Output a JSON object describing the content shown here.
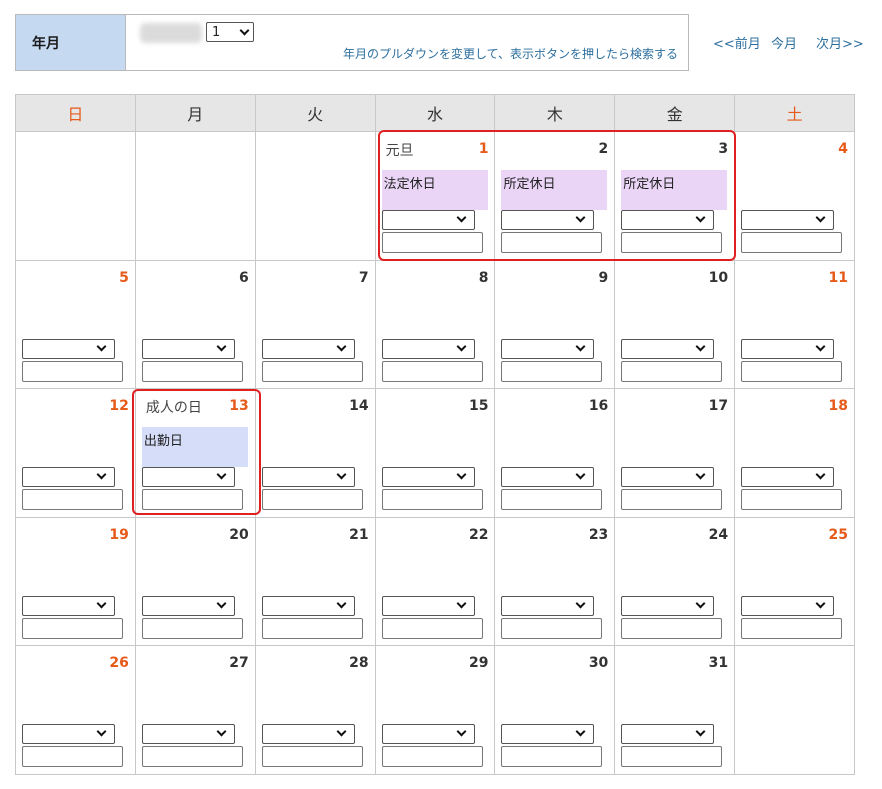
{
  "filter": {
    "label": "年月",
    "month_value": "1",
    "hint": "年月のプルダウンを変更して、表示ボタンを押したら検索する"
  },
  "nav": {
    "prev": "<<前月",
    "current": "今月",
    "next": "次月>>"
  },
  "weekdays": [
    "日",
    "月",
    "火",
    "水",
    "木",
    "金",
    "土"
  ],
  "calendar": {
    "day_1": "1",
    "day_2": "2",
    "day_3": "3",
    "day_4": "4",
    "day_5": "5",
    "day_6": "6",
    "day_7": "7",
    "day_8": "8",
    "day_9": "9",
    "day_10": "10",
    "day_11": "11",
    "day_12": "12",
    "day_13": "13",
    "day_14": "14",
    "day_15": "15",
    "day_16": "16",
    "day_17": "17",
    "day_18": "18",
    "day_19": "19",
    "day_20": "20",
    "day_21": "21",
    "day_22": "22",
    "day_23": "23",
    "day_24": "24",
    "day_25": "25",
    "day_26": "26",
    "day_27": "27",
    "day_28": "28",
    "day_29": "29",
    "day_30": "30",
    "day_31": "31",
    "holiday_1": "元旦",
    "holiday_13": "成人の日",
    "type_1": "法定休日",
    "type_2": "所定休日",
    "type_3": "所定休日",
    "type_13": "出勤日"
  },
  "colors": {
    "weekend_red": "#e65a1a",
    "link_blue": "#2c6f9e",
    "header_bg": "#c5d9f1",
    "highlight_red": "#e02020",
    "legal_holiday_bg": "#ead5f7",
    "workday_bg": "#d6ddf8"
  }
}
